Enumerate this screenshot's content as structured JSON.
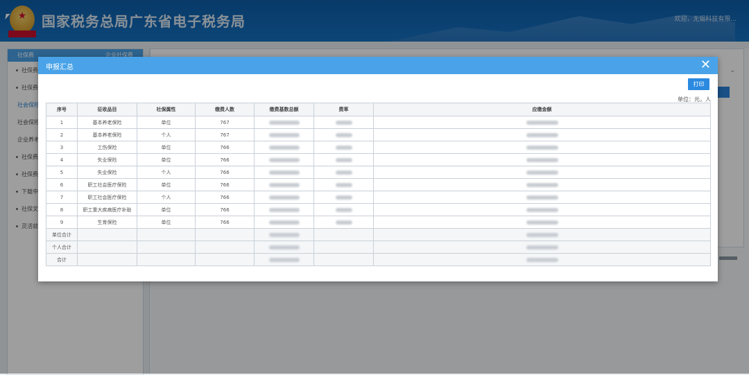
{
  "header": {
    "title": "国家税务总局广东省电子税务局",
    "welcome": "欢迎，无锡科技有限..."
  },
  "sidebar": {
    "head_label": "社保费",
    "head_right": "企业社保费",
    "items": [
      {
        "label": "社保费基",
        "type": "dot"
      },
      {
        "label": "社保费申",
        "type": "dot"
      },
      {
        "label": "社会保险",
        "type": "sub",
        "active": true
      },
      {
        "label": "社会保险",
        "type": "sub"
      },
      {
        "label": "企业养老",
        "type": "sub"
      },
      {
        "label": "社保费清",
        "type": "dot"
      },
      {
        "label": "社保费查",
        "type": "dot"
      },
      {
        "label": "下载中心",
        "type": "dot"
      },
      {
        "label": "社保文书",
        "type": "dot"
      },
      {
        "label": "灵活就业",
        "type": "dot"
      }
    ]
  },
  "modal": {
    "title": "申报汇总",
    "close_icon": "close-icon",
    "print_label": "打印",
    "unit_label": "单位：元，人",
    "columns": [
      "序号",
      "征收品目",
      "社保属性",
      "缴费人数",
      "缴费基数总额",
      "费率",
      "应缴金额"
    ],
    "rows": [
      {
        "no": "1",
        "item": "基本养老保险",
        "attr": "单位",
        "count": "767"
      },
      {
        "no": "2",
        "item": "基本养老保险",
        "attr": "个人",
        "count": "767"
      },
      {
        "no": "3",
        "item": "工伤保险",
        "attr": "单位",
        "count": "766"
      },
      {
        "no": "4",
        "item": "失业保险",
        "attr": "单位",
        "count": "766"
      },
      {
        "no": "5",
        "item": "失业保险",
        "attr": "个人",
        "count": "766"
      },
      {
        "no": "6",
        "item": "职工社会医疗保险",
        "attr": "单位",
        "count": "766"
      },
      {
        "no": "7",
        "item": "职工社会医疗保险",
        "attr": "个人",
        "count": "766"
      },
      {
        "no": "8",
        "item": "职工重大疾病医疗补助",
        "attr": "单位",
        "count": "766"
      },
      {
        "no": "9",
        "item": "生育保险",
        "attr": "单位",
        "count": "766"
      }
    ],
    "summary": [
      {
        "label": "单位合计"
      },
      {
        "label": "个人合计"
      },
      {
        "label": "合计"
      }
    ]
  }
}
